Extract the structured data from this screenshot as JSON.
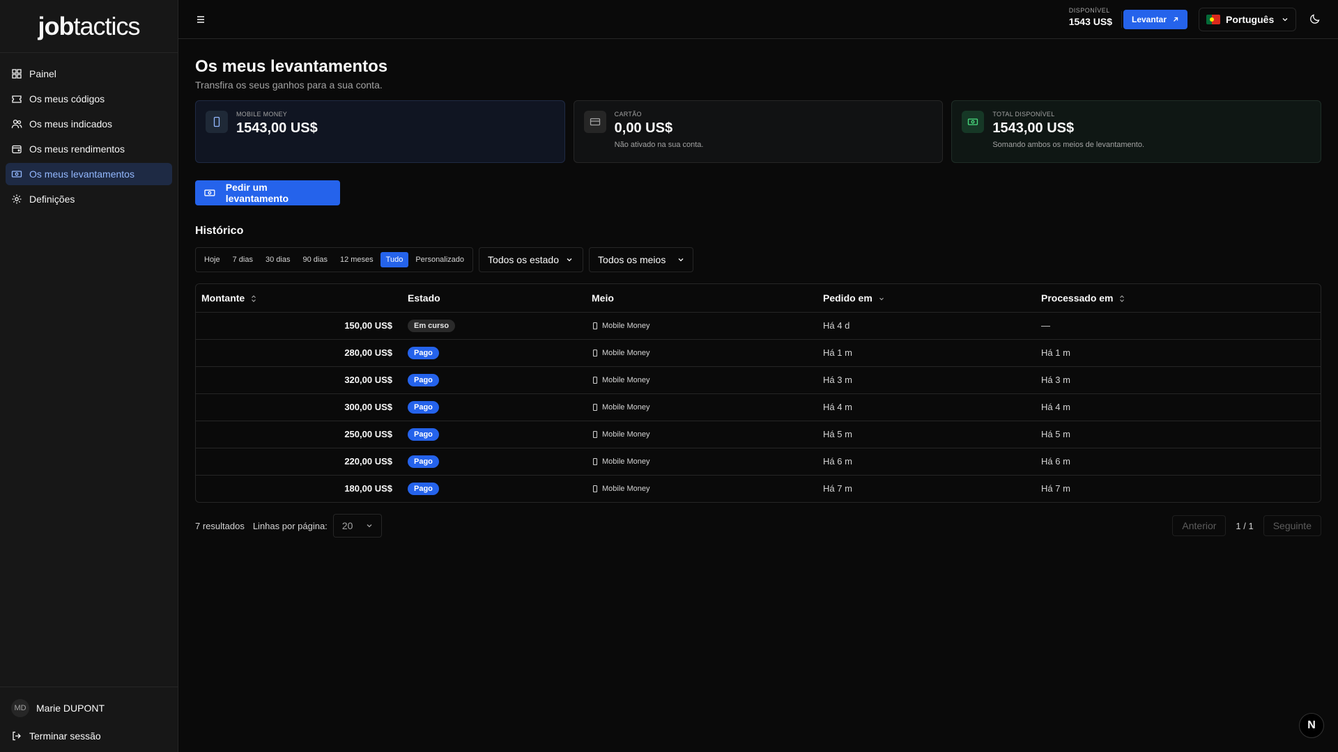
{
  "brand": {
    "logo_bold": "job",
    "logo_light": "tactics"
  },
  "sidebar": {
    "items": [
      {
        "label": "Painel",
        "icon": "dashboard-icon",
        "active": false
      },
      {
        "label": "Os meus códigos",
        "icon": "ticket-icon",
        "active": false
      },
      {
        "label": "Os meus indicados",
        "icon": "users-icon",
        "active": false
      },
      {
        "label": "Os meus rendimentos",
        "icon": "wallet-icon",
        "active": false
      },
      {
        "label": "Os meus levantamentos",
        "icon": "banknote-icon",
        "active": true
      },
      {
        "label": "Definições",
        "icon": "gear-icon",
        "active": false
      }
    ],
    "user": {
      "initials": "MD",
      "name": "Marie DUPONT"
    },
    "logout_label": "Terminar sessão"
  },
  "topbar": {
    "available_label": "DISPONÍVEL",
    "available_value": "1543 US$",
    "withdraw_label": "Levantar",
    "language": "Português"
  },
  "page": {
    "title": "Os meus levantamentos",
    "subtitle": "Transfira os seus ganhos para a sua conta."
  },
  "cards": [
    {
      "label": "MOBILE MONEY",
      "value": "1543,00 US$",
      "note": ""
    },
    {
      "label": "CARTÃO",
      "value": "0,00 US$",
      "note": "Não ativado na sua conta."
    },
    {
      "label": "TOTAL DISPONÍVEL",
      "value": "1543,00 US$",
      "note": "Somando ambos os meios de levantamento."
    }
  ],
  "request_button": "Pedir um levantamento",
  "history": {
    "title": "Histórico",
    "ranges": [
      "Hoje",
      "7 dias",
      "30 dias",
      "90 dias",
      "12 meses",
      "Tudo",
      "Personalizado"
    ],
    "active_range": "Tudo",
    "status_filter": "Todos os estados",
    "method_filter": "Todos os meios",
    "columns": {
      "amount": "Montante",
      "status": "Estado",
      "method": "Meio",
      "requested": "Pedido em",
      "processed": "Processado em"
    },
    "rows": [
      {
        "amount": "150,00 US$",
        "status": "Em curso",
        "paid": false,
        "method": "Mobile Money",
        "requested": "Há 4 d",
        "processed": "—"
      },
      {
        "amount": "280,00 US$",
        "status": "Pago",
        "paid": true,
        "method": "Mobile Money",
        "requested": "Há 1 m",
        "processed": "Há 1 m"
      },
      {
        "amount": "320,00 US$",
        "status": "Pago",
        "paid": true,
        "method": "Mobile Money",
        "requested": "Há 3 m",
        "processed": "Há 3 m"
      },
      {
        "amount": "300,00 US$",
        "status": "Pago",
        "paid": true,
        "method": "Mobile Money",
        "requested": "Há 4 m",
        "processed": "Há 4 m"
      },
      {
        "amount": "250,00 US$",
        "status": "Pago",
        "paid": true,
        "method": "Mobile Money",
        "requested": "Há 5 m",
        "processed": "Há 5 m"
      },
      {
        "amount": "220,00 US$",
        "status": "Pago",
        "paid": true,
        "method": "Mobile Money",
        "requested": "Há 6 m",
        "processed": "Há 6 m"
      },
      {
        "amount": "180,00 US$",
        "status": "Pago",
        "paid": true,
        "method": "Mobile Money",
        "requested": "Há 7 m",
        "processed": "Há 7 m"
      }
    ]
  },
  "pagination": {
    "results": "7 resultados",
    "rows_per_page_label": "Linhas por página:",
    "rows_per_page": "20",
    "prev": "Anterior",
    "page_info": "1 / 1",
    "next": "Seguinte"
  },
  "floating_badge": "N",
  "colors": {
    "accent": "#2563eb",
    "background": "#0a0a0a",
    "sidebar": "#171717"
  }
}
